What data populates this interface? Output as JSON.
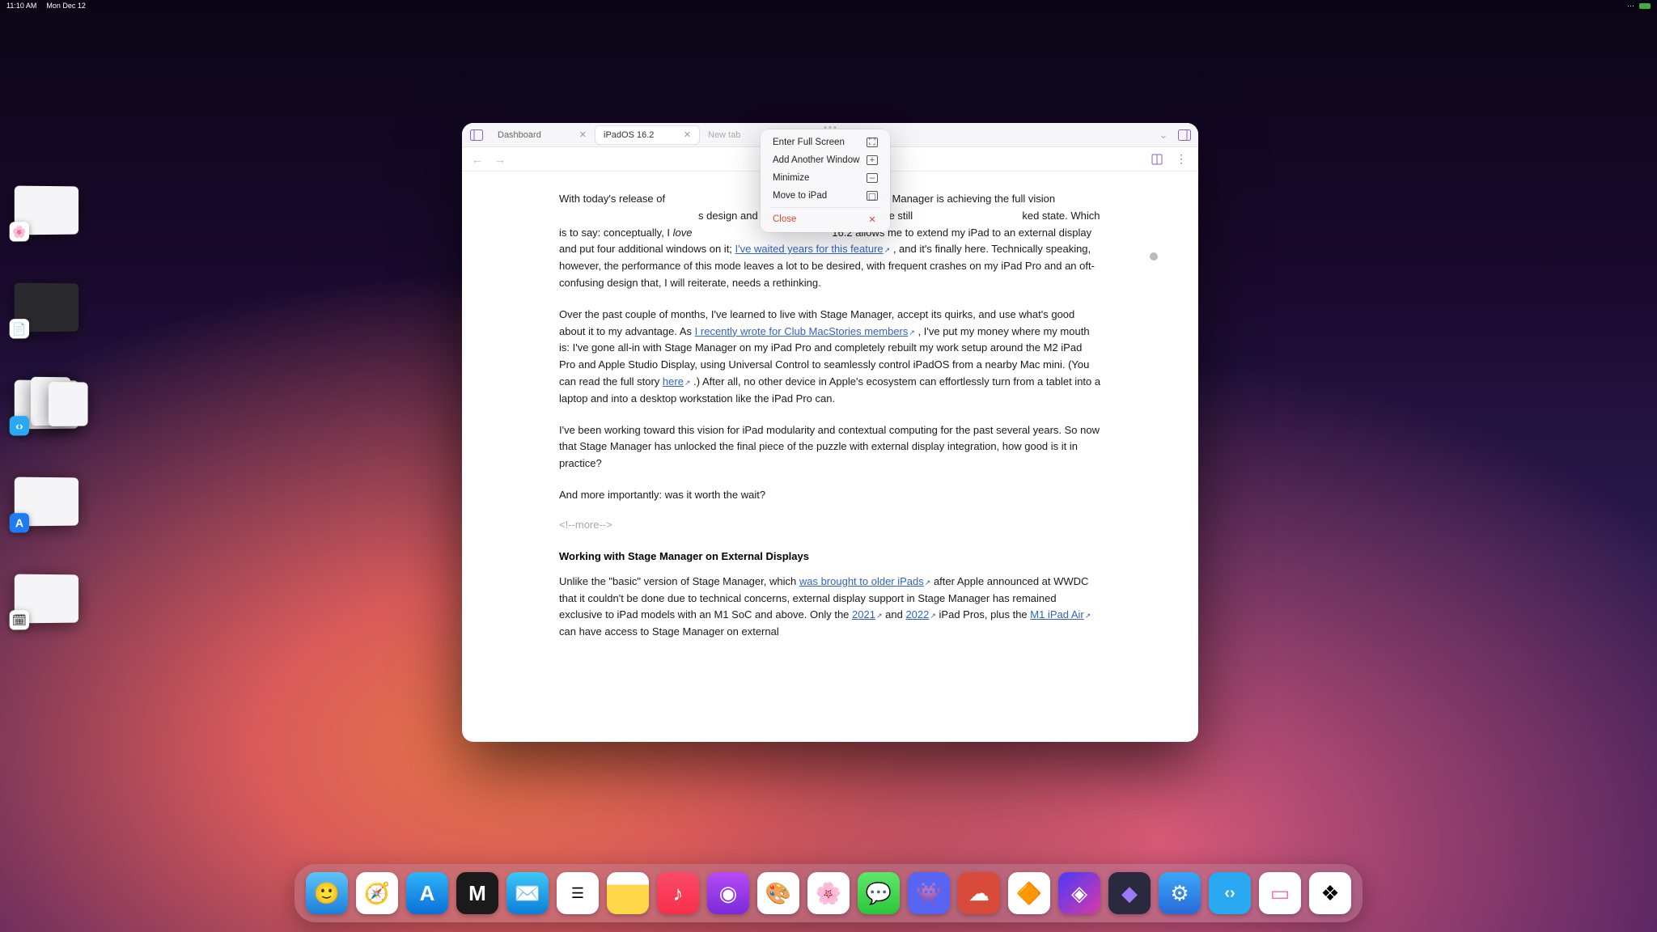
{
  "menubar": {
    "time": "11:10 AM",
    "date": "Mon Dec 12"
  },
  "stage_thumbs": [
    {
      "icon_bg": "#ffffff",
      "icon": "🌸",
      "win_bg": "light",
      "name": "photos"
    },
    {
      "icon_bg": "#ffffff",
      "icon": "📄",
      "win_bg": "dark",
      "name": "document"
    },
    {
      "icon_bg": "#2aa8f2",
      "icon": "‹›",
      "win_bg": "light",
      "name": "code"
    },
    {
      "icon_bg": "#1f7cf0",
      "icon": "A",
      "win_bg": "light",
      "name": "appstore"
    },
    {
      "icon_bg": "#ffffff",
      "icon": "🗓",
      "win_bg": "light",
      "name": "calendar"
    }
  ],
  "tabs": [
    {
      "label": "Dashboard",
      "active": false
    },
    {
      "label": "iPadOS 16.2",
      "active": true
    },
    {
      "label": "New tab",
      "active": false,
      "is_new": true
    }
  ],
  "context_menu": [
    {
      "label": "Enter Full Screen",
      "icon": "fullscreen",
      "danger": false
    },
    {
      "label": "Add Another Window",
      "icon": "add-window",
      "danger": false
    },
    {
      "label": "Minimize",
      "icon": "minimize",
      "danger": false
    },
    {
      "label": "Move to iPad",
      "icon": "ipad",
      "danger": false
    },
    {
      "divider": true
    },
    {
      "label": "Close",
      "icon": "close",
      "danger": true
    }
  ],
  "article": {
    "p1_a": "With today's release of ",
    "p1_b": "tage Manager is achieving the full vision ",
    "p1_c": "s design and technical implementation are still",
    "p1_d": "ked state. Which is to say: conceptually, I ",
    "p1_em": "love",
    "p1_e": " 16.2 allows me to extend my iPad to an external display and put four additional windows on it; ",
    "link1": "I've waited years for this feature",
    "p1_f": ", and it's finally here. Technically speaking, however, the performance of this mode leaves a lot to be desired, with frequent crashes on my iPad Pro and an oft-confusing design that, I will reiterate, needs a rethinking.",
    "p2_a": "Over the past couple of months, I've learned to live with Stage Manager, accept its quirks, and use what's good about it to my advantage. As ",
    "link2": "I recently wrote for Club MacStories members",
    "p2_b": ", I've put my money where my mouth is: I've gone all-in with Stage Manager on my iPad Pro and completely rebuilt my work setup around the M2 iPad Pro and Apple Studio Display, using Universal Control to seamlessly control iPadOS from a nearby Mac mini. (You can read the full story ",
    "link3": "here",
    "p2_c": ".) After all, no other device in Apple's ecosystem can effortlessly turn from a tablet into a laptop and into a desktop workstation like the iPad Pro can.",
    "p3": "I've been working toward this vision for iPad modularity and contextual computing for the past several years. So now that Stage Manager has unlocked the final piece of the puzzle with external display integration, how good is it in practice?",
    "p4": "And more importantly: was it worth the wait?",
    "comment": "<!--more-->",
    "heading": "Working with Stage Manager on External Displays",
    "p5_a": "Unlike the \"basic\" version of Stage Manager, which ",
    "link4": "was brought to older iPads",
    "p5_b": " after Apple announced at WWDC that it couldn't be done due to technical concerns, external display support in Stage Manager has remained exclusive to iPad models with an M1 SoC and above. Only the ",
    "link5": "2021",
    "p5_c": " and ",
    "link6": "2022",
    "p5_d": " iPad Pros, plus the ",
    "link7": "M1 iPad Air",
    "p5_e": " can have access to Stage Manager on external "
  },
  "dock": [
    {
      "name": "finder",
      "bg": "linear-gradient(#2fb4f7,#0a6fd8)",
      "glyph": "😊"
    },
    {
      "name": "safari",
      "bg": "#fff",
      "glyph": "🧭"
    },
    {
      "name": "appstore",
      "bg": "linear-gradient(#2fb4f7,#0a6fd8)",
      "glyph": "A"
    },
    {
      "name": "matter",
      "bg": "#1a1a1a",
      "glyph": "M"
    },
    {
      "name": "mail",
      "bg": "linear-gradient(#3fc7f7,#0a7fd8)",
      "glyph": "✉️"
    },
    {
      "name": "reminders",
      "bg": "#fff",
      "glyph": "☰"
    },
    {
      "name": "notes",
      "bg": "linear-gradient(#fff,#ffd84a)",
      "glyph": ""
    },
    {
      "name": "music",
      "bg": "linear-gradient(#fa4a6a,#f7304a)",
      "glyph": "♪"
    },
    {
      "name": "podcasts",
      "bg": "linear-gradient(#b74af7,#7a2ad8)",
      "glyph": "◉"
    },
    {
      "name": "freeform",
      "bg": "#fff",
      "glyph": "🎨"
    },
    {
      "name": "photos",
      "bg": "#fff",
      "glyph": "🌸"
    },
    {
      "name": "messages",
      "bg": "linear-gradient(#5fe76a,#2ac73a)",
      "glyph": "💬"
    },
    {
      "name": "discord",
      "bg": "#5865f2",
      "glyph": "👾"
    },
    {
      "name": "app1",
      "bg": "#d84a3a",
      "glyph": "☁"
    },
    {
      "name": "app2",
      "bg": "#fff",
      "glyph": "🔶"
    },
    {
      "name": "shortcuts",
      "bg": "linear-gradient(#4a3af7,#d83aa8)",
      "glyph": "◈"
    },
    {
      "name": "obsidian",
      "bg": "#2a2a3e",
      "glyph": "◆"
    },
    {
      "name": "app3",
      "bg": "linear-gradient(#3aa8f7,#2a6ad8)",
      "glyph": "⚙"
    },
    {
      "name": "vscode",
      "bg": "#2aa8f2",
      "glyph": "‹›"
    },
    {
      "name": "app4",
      "bg": "#fff",
      "glyph": "▭"
    },
    {
      "name": "app5",
      "bg": "#fff",
      "glyph": "❖"
    }
  ]
}
